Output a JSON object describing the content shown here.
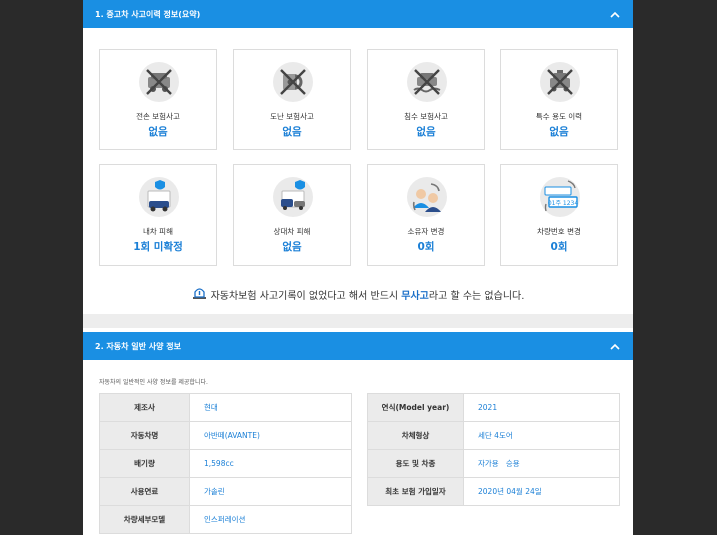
{
  "section1": {
    "title": "1. 중고차 사고이력 정보(요약)",
    "cards": [
      {
        "label": "전손 보험사고",
        "value": "없음",
        "icon": "total-loss-icon"
      },
      {
        "label": "도난 보험사고",
        "value": "없음",
        "icon": "theft-icon"
      },
      {
        "label": "침수 보험사고",
        "value": "없음",
        "icon": "flood-icon"
      },
      {
        "label": "특수 용도 이력",
        "value": "없음",
        "icon": "special-use-icon"
      },
      {
        "label": "내차 피해",
        "value": "1회 미확정",
        "icon": "my-car-damage-icon"
      },
      {
        "label": "상대차 피해",
        "value": "없음",
        "icon": "other-car-damage-icon"
      },
      {
        "label": "소유자 변경",
        "value": "0회",
        "icon": "owner-change-icon"
      },
      {
        "label": "차량번호 변경",
        "value": "0회",
        "icon": "plate-change-icon",
        "plate_text": "01주 1234"
      }
    ],
    "notice": {
      "prefix": "자동차보험 사고기록이 없었다고 해서 반드시",
      "emphasis": "무사고",
      "suffix": "라고 할 수는 없습니다."
    }
  },
  "section2": {
    "title": "2. 자동차 일반 사양 정보",
    "subtitle": "자동차의 일반적인 사양 정보를 제공합니다.",
    "left_rows": [
      {
        "key": "제조사",
        "value": "현대"
      },
      {
        "key": "자동차명",
        "value": "아반떼(AVANTE)"
      },
      {
        "key": "배기량",
        "value": "1,598cc"
      },
      {
        "key": "사용연료",
        "value": "가솔린"
      },
      {
        "key": "차량세부모델",
        "value": "인스퍼레이션"
      }
    ],
    "right_rows": [
      {
        "key": "연식(Model year)",
        "value": "2021"
      },
      {
        "key": "차체형상",
        "value": "세단 4도어"
      },
      {
        "key": "용도 및 차종",
        "value": "자가용   승용"
      },
      {
        "key": "최초 보험 가입일자",
        "value": "2020년 04월 24일"
      }
    ]
  },
  "colors": {
    "accent": "#1a8fe3",
    "value_blue": "#1a7fd6",
    "background": "#2a2a2a"
  }
}
